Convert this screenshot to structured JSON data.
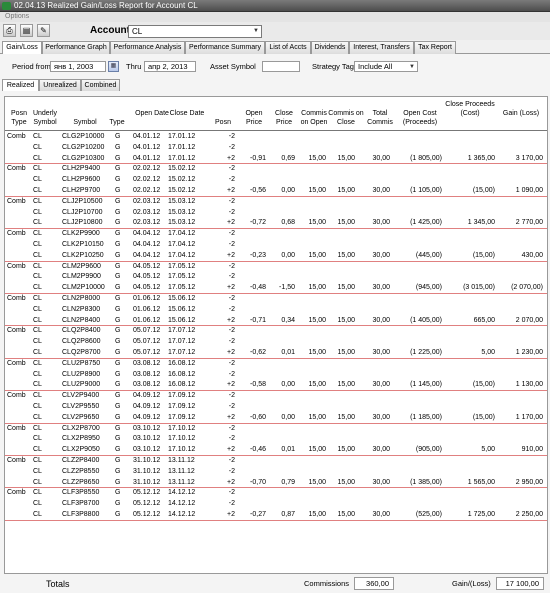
{
  "window": {
    "title": "02.04.13 Realized Gain/Loss Report for Account CL"
  },
  "menu": {
    "options_label": "Options"
  },
  "toolbar": {
    "icons": [
      "print-icon",
      "print-preview-icon",
      "save-report-icon"
    ]
  },
  "account": {
    "label": "Account",
    "value": "CL"
  },
  "tabs": [
    {
      "label": "Gain/Loss",
      "active": true
    },
    {
      "label": "Performance Graph"
    },
    {
      "label": "Performance Analysis"
    },
    {
      "label": "Performance Summary"
    },
    {
      "label": "List of Accts"
    },
    {
      "label": "Dividends"
    },
    {
      "label": "Interest, Transfers"
    },
    {
      "label": "Tax Report"
    }
  ],
  "filters": {
    "period_from_label": "Period from",
    "period_from_value": "янв 1, 2003",
    "thru_label": "Thru",
    "thru_value": "апр 2, 2013",
    "asset_symbol_label": "Asset Symbol",
    "asset_symbol_value": "",
    "strategy_tag_label": "Strategy Tag",
    "strategy_tag_value": "Include All"
  },
  "subtabs": [
    {
      "label": "Realized",
      "active": true
    },
    {
      "label": "Unrealized"
    },
    {
      "label": "Combined"
    }
  ],
  "columns": {
    "posn_type": "Posn Type",
    "underly_symbol": "Underly Symbol",
    "symbol": "Symbol",
    "type": "Type",
    "open_date": "Open Date",
    "close_date": "Close Date",
    "posn": "Posn",
    "open_price": "Open Price",
    "close_price": "Close Price",
    "commis_open": "Commis on Open",
    "commis_close": "Commis on Close",
    "total_commis": "Total Commis",
    "open_cost": "Open Cost (Proceeds)",
    "close_proceeds": "Close Proceeds (Cost)",
    "gain": "Gain (Loss)"
  },
  "groups": [
    {
      "rows": [
        {
          "pt": "Comb",
          "u": "CL",
          "sym": "CLG2P10000",
          "t": "G",
          "od": "04.01.12",
          "cd": "17.01.12",
          "p": "-2"
        },
        {
          "u": "CL",
          "sym": "CLG2P10200",
          "t": "G",
          "od": "04.01.12",
          "cd": "17.01.12",
          "p": "-2"
        },
        {
          "u": "CL",
          "sym": "CLG2P10300",
          "t": "G",
          "od": "04.01.12",
          "cd": "17.01.12",
          "p": "+2",
          "op": "-0,91",
          "cp": "0,69",
          "co": "15,00",
          "cc": "15,00",
          "tc": "30,00",
          "oc": "(1 805,00)",
          "pr": "1 365,00",
          "g": "3 170,00"
        }
      ]
    },
    {
      "rows": [
        {
          "pt": "Comb",
          "u": "CL",
          "sym": "CLH2P9400",
          "t": "G",
          "od": "02.02.12",
          "cd": "15.02.12",
          "p": "-2"
        },
        {
          "u": "CL",
          "sym": "CLH2P9600",
          "t": "G",
          "od": "02.02.12",
          "cd": "15.02.12",
          "p": "-2"
        },
        {
          "u": "CL",
          "sym": "CLH2P9700",
          "t": "G",
          "od": "02.02.12",
          "cd": "15.02.12",
          "p": "+2",
          "op": "-0,56",
          "cp": "0,00",
          "co": "15,00",
          "cc": "15,00",
          "tc": "30,00",
          "oc": "(1 105,00)",
          "pr": "(15,00)",
          "g": "1 090,00"
        }
      ]
    },
    {
      "rows": [
        {
          "pt": "Comb",
          "u": "CL",
          "sym": "CLJ2P10500",
          "t": "G",
          "od": "02.03.12",
          "cd": "15.03.12",
          "p": "-2"
        },
        {
          "u": "CL",
          "sym": "CLJ2P10700",
          "t": "G",
          "od": "02.03.12",
          "cd": "15.03.12",
          "p": "-2"
        },
        {
          "u": "CL",
          "sym": "CLJ2P10800",
          "t": "G",
          "od": "02.03.12",
          "cd": "15.03.12",
          "p": "+2",
          "op": "-0,72",
          "cp": "0,68",
          "co": "15,00",
          "cc": "15,00",
          "tc": "30,00",
          "oc": "(1 425,00)",
          "pr": "1 345,00",
          "g": "2 770,00"
        }
      ]
    },
    {
      "rows": [
        {
          "pt": "Comb",
          "u": "CL",
          "sym": "CLK2P9900",
          "t": "G",
          "od": "04.04.12",
          "cd": "17.04.12",
          "p": "-2"
        },
        {
          "u": "CL",
          "sym": "CLK2P10150",
          "t": "G",
          "od": "04.04.12",
          "cd": "17.04.12",
          "p": "-2"
        },
        {
          "u": "CL",
          "sym": "CLK2P10250",
          "t": "G",
          "od": "04.04.12",
          "cd": "17.04.12",
          "p": "+2",
          "op": "-0,23",
          "cp": "0,00",
          "co": "15,00",
          "cc": "15,00",
          "tc": "30,00",
          "oc": "(445,00)",
          "pr": "(15,00)",
          "g": "430,00"
        }
      ]
    },
    {
      "rows": [
        {
          "pt": "Comb",
          "u": "CL",
          "sym": "CLM2P9600",
          "t": "G",
          "od": "04.05.12",
          "cd": "17.05.12",
          "p": "-2"
        },
        {
          "u": "CL",
          "sym": "CLM2P9900",
          "t": "G",
          "od": "04.05.12",
          "cd": "17.05.12",
          "p": "-2"
        },
        {
          "u": "CL",
          "sym": "CLM2P10000",
          "t": "G",
          "od": "04.05.12",
          "cd": "17.05.12",
          "p": "+2",
          "op": "-0,48",
          "cp": "-1,50",
          "co": "15,00",
          "cc": "15,00",
          "tc": "30,00",
          "oc": "(945,00)",
          "pr": "(3 015,00)",
          "g": "(2 070,00)"
        }
      ]
    },
    {
      "rows": [
        {
          "pt": "Comb",
          "u": "CL",
          "sym": "CLN2P8000",
          "t": "G",
          "od": "01.06.12",
          "cd": "15.06.12",
          "p": "-2"
        },
        {
          "u": "CL",
          "sym": "CLN2P8300",
          "t": "G",
          "od": "01.06.12",
          "cd": "15.06.12",
          "p": "-2"
        },
        {
          "u": "CL",
          "sym": "CLN2P8400",
          "t": "G",
          "od": "01.06.12",
          "cd": "15.06.12",
          "p": "+2",
          "op": "-0,71",
          "cp": "0,34",
          "co": "15,00",
          "cc": "15,00",
          "tc": "30,00",
          "oc": "(1 405,00)",
          "pr": "665,00",
          "g": "2 070,00"
        }
      ]
    },
    {
      "rows": [
        {
          "pt": "Comb",
          "u": "CL",
          "sym": "CLQ2P8400",
          "t": "G",
          "od": "05.07.12",
          "cd": "17.07.12",
          "p": "-2"
        },
        {
          "u": "CL",
          "sym": "CLQ2P8600",
          "t": "G",
          "od": "05.07.12",
          "cd": "17.07.12",
          "p": "-2"
        },
        {
          "u": "CL",
          "sym": "CLQ2P8700",
          "t": "G",
          "od": "05.07.12",
          "cd": "17.07.12",
          "p": "+2",
          "op": "-0,62",
          "cp": "0,01",
          "co": "15,00",
          "cc": "15,00",
          "tc": "30,00",
          "oc": "(1 225,00)",
          "pr": "5,00",
          "g": "1 230,00"
        }
      ]
    },
    {
      "rows": [
        {
          "pt": "Comb",
          "u": "CL",
          "sym": "CLU2P8750",
          "t": "G",
          "od": "03.08.12",
          "cd": "16.08.12",
          "p": "-2"
        },
        {
          "u": "CL",
          "sym": "CLU2P8900",
          "t": "G",
          "od": "03.08.12",
          "cd": "16.08.12",
          "p": "-2"
        },
        {
          "u": "CL",
          "sym": "CLU2P9000",
          "t": "G",
          "od": "03.08.12",
          "cd": "16.08.12",
          "p": "+2",
          "op": "-0,58",
          "cp": "0,00",
          "co": "15,00",
          "cc": "15,00",
          "tc": "30,00",
          "oc": "(1 145,00)",
          "pr": "(15,00)",
          "g": "1 130,00"
        }
      ]
    },
    {
      "rows": [
        {
          "pt": "Comb",
          "u": "CL",
          "sym": "CLV2P9400",
          "t": "G",
          "od": "04.09.12",
          "cd": "17.09.12",
          "p": "-2"
        },
        {
          "u": "CL",
          "sym": "CLV2P9550",
          "t": "G",
          "od": "04.09.12",
          "cd": "17.09.12",
          "p": "-2"
        },
        {
          "u": "CL",
          "sym": "CLV2P9650",
          "t": "G",
          "od": "04.09.12",
          "cd": "17.09.12",
          "p": "+2",
          "op": "-0,60",
          "cp": "0,00",
          "co": "15,00",
          "cc": "15,00",
          "tc": "30,00",
          "oc": "(1 185,00)",
          "pr": "(15,00)",
          "g": "1 170,00"
        }
      ]
    },
    {
      "rows": [
        {
          "pt": "Comb",
          "u": "CL",
          "sym": "CLX2P8700",
          "t": "G",
          "od": "03.10.12",
          "cd": "17.10.12",
          "p": "-2"
        },
        {
          "u": "CL",
          "sym": "CLX2P8950",
          "t": "G",
          "od": "03.10.12",
          "cd": "17.10.12",
          "p": "-2"
        },
        {
          "u": "CL",
          "sym": "CLX2P9050",
          "t": "G",
          "od": "03.10.12",
          "cd": "17.10.12",
          "p": "+2",
          "op": "-0,46",
          "cp": "0,01",
          "co": "15,00",
          "cc": "15,00",
          "tc": "30,00",
          "oc": "(905,00)",
          "pr": "5,00",
          "g": "910,00"
        }
      ]
    },
    {
      "rows": [
        {
          "pt": "Comb",
          "u": "CL",
          "sym": "CLZ2P8400",
          "t": "G",
          "od": "31.10.12",
          "cd": "13.11.12",
          "p": "-2"
        },
        {
          "u": "CL",
          "sym": "CLZ2P8550",
          "t": "G",
          "od": "31.10.12",
          "cd": "13.11.12",
          "p": "-2"
        },
        {
          "u": "CL",
          "sym": "CLZ2P8650",
          "t": "G",
          "od": "31.10.12",
          "cd": "13.11.12",
          "p": "+2",
          "op": "-0,70",
          "cp": "0,79",
          "co": "15,00",
          "cc": "15,00",
          "tc": "30,00",
          "oc": "(1 385,00)",
          "pr": "1 565,00",
          "g": "2 950,00"
        }
      ]
    },
    {
      "rows": [
        {
          "pt": "Comb",
          "u": "CL",
          "sym": "CLF3P8550",
          "t": "G",
          "od": "05.12.12",
          "cd": "14.12.12",
          "p": "-2"
        },
        {
          "u": "CL",
          "sym": "CLF3P8700",
          "t": "G",
          "od": "05.12.12",
          "cd": "14.12.12",
          "p": "-2"
        },
        {
          "u": "CL",
          "sym": "CLF3P8800",
          "t": "G",
          "od": "05.12.12",
          "cd": "14.12.12",
          "p": "+2",
          "op": "-0,27",
          "cp": "0,87",
          "co": "15,00",
          "cc": "15,00",
          "tc": "30,00",
          "oc": "(525,00)",
          "pr": "1 725,00",
          "g": "2 250,00"
        }
      ]
    }
  ],
  "totals": {
    "label": "Totals",
    "commissions_label": "Commissions",
    "commissions_value": "360,00",
    "gain_label": "Gain/(Loss)",
    "gain_value": "17 100,00"
  }
}
